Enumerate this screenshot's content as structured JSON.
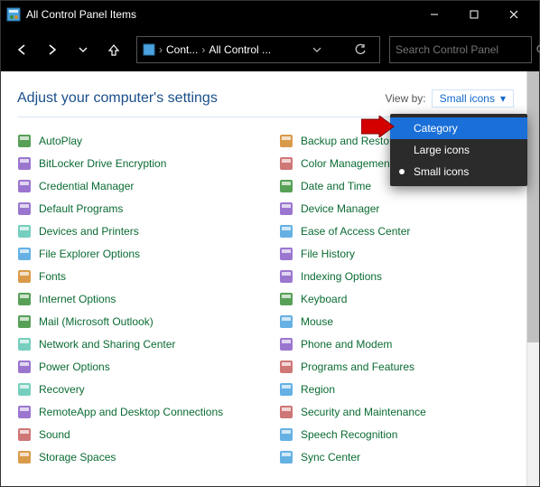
{
  "window": {
    "title": "All Control Panel Items"
  },
  "breadcrumb": {
    "first": "Cont...",
    "second": "All Control ..."
  },
  "search": {
    "placeholder": "Search Control Panel"
  },
  "heading": "Adjust your computer's settings",
  "viewby": {
    "label": "View by:",
    "current": "Small icons"
  },
  "popup": {
    "options": [
      {
        "label": "Category"
      },
      {
        "label": "Large icons"
      },
      {
        "label": "Small icons"
      }
    ]
  },
  "col1": [
    "AutoPlay",
    "BitLocker Drive Encryption",
    "Credential Manager",
    "Default Programs",
    "Devices and Printers",
    "File Explorer Options",
    "Fonts",
    "Internet Options",
    "Mail (Microsoft Outlook)",
    "Network and Sharing Center",
    "Power Options",
    "Recovery",
    "RemoteApp and Desktop Connections",
    "Sound",
    "Storage Spaces"
  ],
  "col2": [
    "Backup and Restore (Windows",
    "Color Management",
    "Date and Time",
    "Device Manager",
    "Ease of Access Center",
    "File History",
    "Indexing Options",
    "Keyboard",
    "Mouse",
    "Phone and Modem",
    "Programs and Features",
    "Region",
    "Security and Maintenance",
    "Speech Recognition",
    "Sync Center"
  ]
}
